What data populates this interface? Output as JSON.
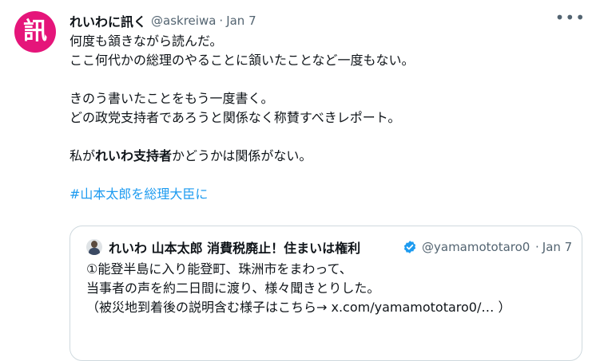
{
  "tweet": {
    "avatar_text": "訊",
    "display_name": "れいわに訊く",
    "handle": "@askreiwa",
    "separator": "·",
    "date": "Jan 7",
    "more_icon": "more-horizontal-icon",
    "lines": [
      "何度も頷きながら読んだ。",
      "ここ何代かの総理のやることに頷いたことなど一度もない。",
      "",
      "きのう書いたことをもう一度書く。",
      "どの政党支持者であろうと関係なく称賛すべきレポート。",
      "",
      {
        "before": "私が",
        "bold": "れいわ支持者",
        "after": "かどうかは関係がない。"
      },
      ""
    ],
    "hashtag": "#山本太郎を総理大臣に"
  },
  "quote": {
    "display_name": "れいわ 山本太郎 消費税廃止！住まいは権利",
    "verified": true,
    "handle": "@yamamototaro0",
    "separator": "·",
    "date": "Jan 7",
    "lines": [
      "①能登半島に入り能登町、珠洲市をまわって、",
      "当事者の声を約二日間に渡り、様々聞きとりした。",
      "（被災地到着後の説明含む様子はこちら→ x.com/yamamototaro0/… ）"
    ]
  },
  "colors": {
    "avatar_bg": "#e5157a",
    "link": "#1d9bf0",
    "verified": "#1d9bf0",
    "secondary_text": "#536471",
    "border": "#cfd9de"
  }
}
